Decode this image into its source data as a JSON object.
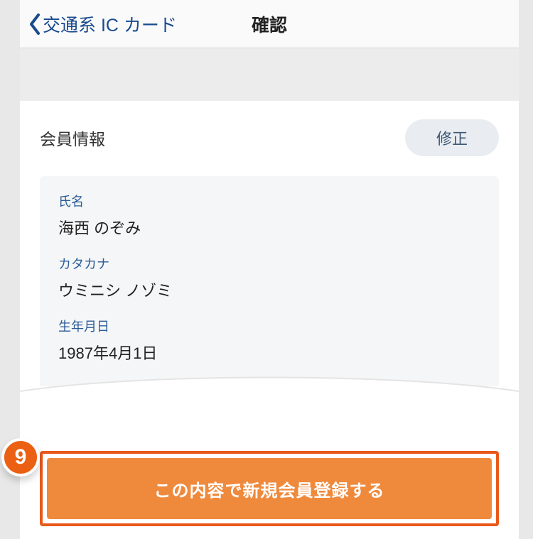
{
  "header": {
    "back_label": "交通系 IC カード",
    "title": "確認"
  },
  "section": {
    "title": "会員情報",
    "edit_label": "修正"
  },
  "fields": {
    "name_label": "氏名",
    "name_value": "海西 のぞみ",
    "kana_label": "カタカナ",
    "kana_value": "ウミニシ ノゾミ",
    "dob_label": "生年月日",
    "dob_value": "1987年4月1日"
  },
  "cta": {
    "label": "この内容で新規会員登録する"
  },
  "step": {
    "number": "9"
  }
}
